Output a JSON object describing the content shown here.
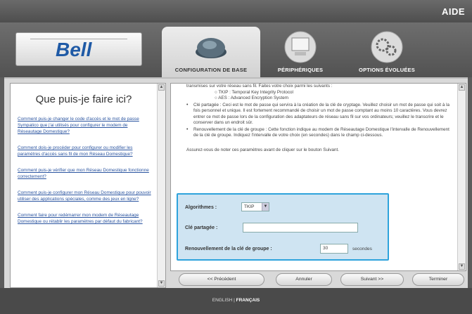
{
  "topbar": {
    "help_label": "AIDE"
  },
  "logo": {
    "text": "Bell"
  },
  "tabs": [
    {
      "label": "CONFIGURATION DE BASE",
      "active": true
    },
    {
      "label": "PÉRIPHÉRIQUES",
      "active": false
    },
    {
      "label": "OPTIONS ÉVOLUÉES",
      "active": false
    }
  ],
  "help": {
    "title": "Que puis-je faire ici?",
    "links": [
      "Comment puis-je changer le code d'accès et le mot de passe Sympatico que j'ai utilisés pour configurer le modem de Réseautage Domestique?",
      "Comment dois-je procéder pour configurer ou modifier les paramètres d'accès sans fil de mon Réseau Domestique?",
      "Comment puis-je vérifier que mon Réseau Domestique fonctionne correctement?",
      "Comment puis-je configurer mon Réseau Domestique pour pouvoir utiliser des applications spéciales, comme des jeux en ligne?",
      "Comment faire pour redémarrer mon modem de Réseautage Domestique ou rétablir les paramètres par défaut du fabricant?"
    ]
  },
  "content": {
    "intro": "transmises sur votre réseau sans fil. Faites votre choix parmi les suivants :",
    "sub1": "○ TKIP : Temporal Key Integrity Protocol",
    "sub2": "○ AES : Advanced Encryption System",
    "bullet1": "Clé partagée : Ceci est le mot de passe qui servira à la création de la clé de cryptage. Veuillez choisir un mot de passe qui soit à la fois personnel et unique. Il est fortement recommandé de choisir un mot de passe comptant au moins 10 caractères. Vous devrez entrer ce mot de passe lors de la configuration des adaptateurs de réseau sans fil sur vos ordinateurs; veuillez le transcrire et le conserver dans un endroit sûr.",
    "bullet2": "Renouvellement de la clé de groupe : Cette fonction indique au modem de Réseautage Domestique l'intervalle de Renouvellement de la clé de groupe. Indiquez l'intervalle de votre choix (en secondes) dans le champ ci-dessous.",
    "note": "Assurez-vous de noter ces paramètres avant de cliquer sur le bouton Suivant."
  },
  "form": {
    "algorithms_label": "Algorithmes :",
    "algorithms_value": "TKIP",
    "shared_key_label": "Clé partagée :",
    "shared_key_value": "",
    "renewal_label": "Renouvellement de la clé de groupe :",
    "renewal_value": "30",
    "renewal_unit": "secondes"
  },
  "buttons": {
    "previous": "<< Précédent",
    "cancel": "Annuler",
    "next": "Suivant >>",
    "finish": "Terminer"
  },
  "footer": {
    "lang_en": "ENGLISH",
    "separator": "|",
    "lang_fr": "FRANÇAIS"
  },
  "colors": {
    "highlight_border": "#2ea3dc",
    "highlight_bg": "#cfe4f2",
    "link": "#2a54a0",
    "brand": "#1f5aa6"
  }
}
